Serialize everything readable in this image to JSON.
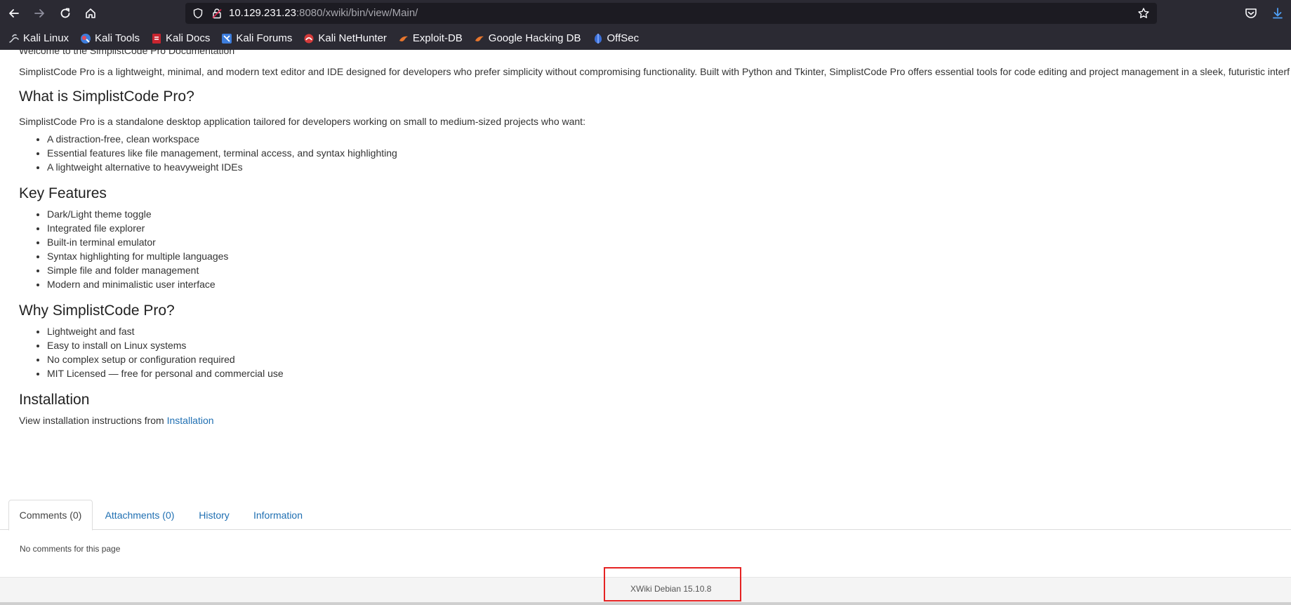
{
  "browser": {
    "url_host": "10.129.231.23",
    "url_rest": ":8080/xwiki/bin/view/Main/",
    "bookmarks": [
      {
        "label": "Kali Linux"
      },
      {
        "label": "Kali Tools"
      },
      {
        "label": "Kali Docs"
      },
      {
        "label": "Kali Forums"
      },
      {
        "label": "Kali NetHunter"
      },
      {
        "label": "Exploit-DB"
      },
      {
        "label": "Google Hacking DB"
      },
      {
        "label": "OffSec"
      }
    ]
  },
  "page": {
    "welcome": "Welcome to the SimplistCode Pro Documentation",
    "intro": "SimplistCode Pro is a lightweight, minimal, and modern text editor and IDE designed for developers who prefer simplicity without compromising functionality. Built with Python and Tkinter, SimplistCode Pro offers essential tools for code editing and project management in a sleek, futuristic interf",
    "sections": [
      {
        "heading": "What is SimplistCode Pro?",
        "intro": "SimplistCode Pro is a standalone desktop application tailored for developers working on small to medium-sized projects who want:",
        "items": [
          "A distraction-free, clean workspace",
          "Essential features like file management, terminal access, and syntax highlighting",
          "A lightweight alternative to heavyweight IDEs"
        ]
      },
      {
        "heading": "Key Features",
        "items": [
          "Dark/Light theme toggle",
          "Integrated file explorer",
          "Built-in terminal emulator",
          "Syntax highlighting for multiple languages",
          "Simple file and folder management",
          "Modern and minimalistic user interface"
        ]
      },
      {
        "heading": "Why SimplistCode Pro?",
        "items": [
          "Lightweight and fast",
          "Easy to install on Linux systems",
          "No complex setup or configuration required",
          "MIT Licensed — free for personal and commercial use"
        ]
      },
      {
        "heading": "Installation",
        "text": "View installation instructions from ",
        "link": "Installation"
      }
    ],
    "tabs": [
      {
        "label": "Comments (0)",
        "active": true
      },
      {
        "label": "Attachments (0)",
        "active": false
      },
      {
        "label": "History",
        "active": false
      },
      {
        "label": "Information",
        "active": false
      }
    ],
    "no_comments": "No comments for this page",
    "footer_version": "XWiki Debian 15.10.8"
  },
  "colors": {
    "chrome_bg": "#2b2a33",
    "urlbar_bg": "#1c1b22",
    "link": "#1f6fb2",
    "highlight_box": "#e52323"
  },
  "icons": [
    "back-arrow-icon",
    "forward-arrow-icon",
    "reload-icon",
    "home-icon",
    "shield-icon",
    "lock-icon",
    "star-icon",
    "pocket-icon",
    "download-icon"
  ]
}
